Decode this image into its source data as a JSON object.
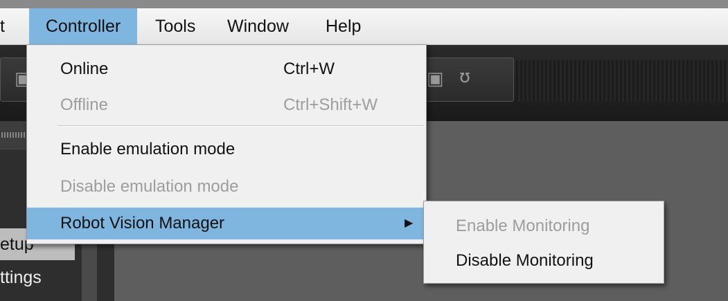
{
  "menubar": {
    "items": [
      {
        "label": "t"
      },
      {
        "label": "Controller"
      },
      {
        "label": "Tools"
      },
      {
        "label": "Window"
      },
      {
        "label": "Help"
      }
    ]
  },
  "controller_menu": {
    "online": {
      "label": "Online",
      "shortcut": "Ctrl+W"
    },
    "offline": {
      "label": "Offline",
      "shortcut": "Ctrl+Shift+W"
    },
    "enable_emulation": {
      "label": "Enable emulation mode"
    },
    "disable_emulation": {
      "label": "Disable emulation mode"
    },
    "robot_vision": {
      "label": "Robot Vision Manager"
    }
  },
  "submenu": {
    "enable_monitoring": {
      "label": "Enable Monitoring"
    },
    "disable_monitoring": {
      "label": "Disable Monitoring"
    }
  },
  "left_panel": {
    "item1": "etup",
    "item2": "ttings"
  },
  "colors": {
    "highlight": "#7eb6e0",
    "menu_bg": "#f0f0f0",
    "disabled_text": "#9d9d9d"
  }
}
